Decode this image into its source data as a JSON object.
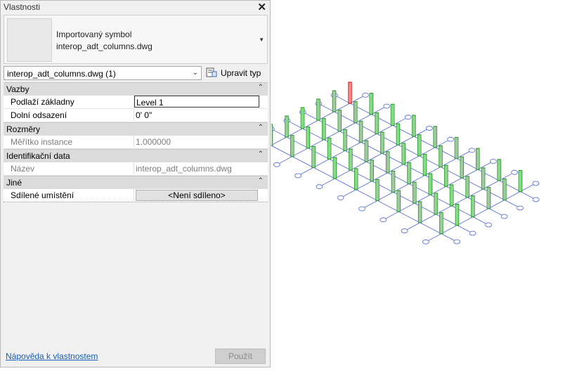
{
  "panel": {
    "title": "Vlastnosti",
    "type_selector": {
      "family": "Importovaný symbol",
      "type": "interop_adt_columns.dwg"
    },
    "instance_filter": "interop_adt_columns.dwg (1)",
    "edit_type_label": "Upravit typ",
    "groups": [
      {
        "name": "Vazby",
        "rows": [
          {
            "key": "Podlaží základny",
            "value": "Level 1"
          },
          {
            "key": "Dolní odsazení",
            "value": "0'  0\""
          }
        ]
      },
      {
        "name": "Rozměry",
        "rows": [
          {
            "key": "Měřítko instance",
            "value": "1.000000"
          }
        ]
      },
      {
        "name": "Identifikační data",
        "rows": [
          {
            "key": "Název",
            "value": "interop_adt_columns.dwg"
          }
        ]
      },
      {
        "name": "Jiné",
        "rows": [
          {
            "key": "Sdílené umístění",
            "value": "<Není sdíleno>"
          }
        ]
      }
    ],
    "help_link": "Nápověda k vlastnostem",
    "apply_label": "Použít"
  },
  "viewport": {
    "line_color": "#4a63d6",
    "column_color": "#2f9a2f",
    "selected_column_color": "#d42020",
    "bubble_color": "#4a63d6",
    "rows": 6,
    "cols": 9
  }
}
